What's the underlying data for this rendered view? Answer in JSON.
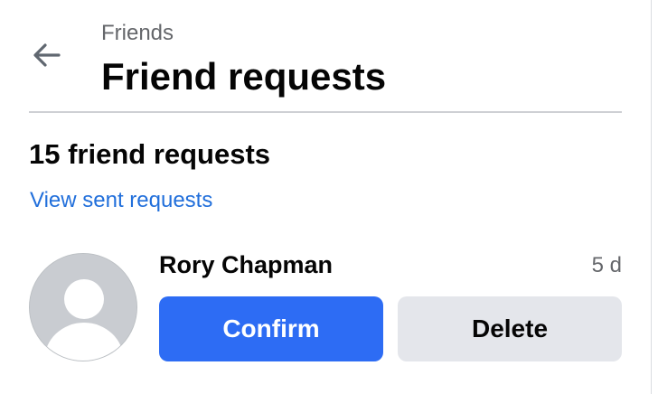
{
  "header": {
    "breadcrumb": "Friends",
    "title": "Friend requests",
    "back_icon": "arrow-left-icon"
  },
  "summary": {
    "count_text": "15 friend requests",
    "sent_link": "View sent requests"
  },
  "requests": [
    {
      "name": "Rory Chapman",
      "time": "5 d",
      "avatar_icon": "default-avatar-icon",
      "confirm_label": "Confirm",
      "delete_label": "Delete"
    }
  ],
  "colors": {
    "accent": "#2d6cf4",
    "link": "#216fdb",
    "secondary_button": "#e4e6eb",
    "muted_text": "#65676b"
  }
}
